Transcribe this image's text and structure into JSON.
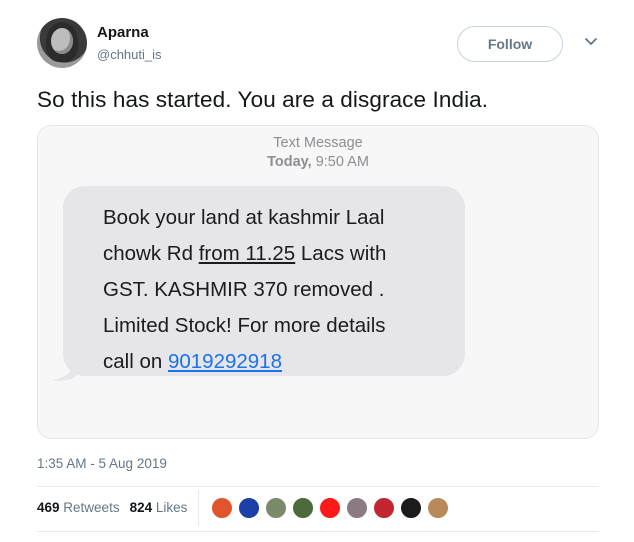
{
  "author": {
    "name": "Aparna",
    "handle": "@chhuti_is",
    "avatar_icon": "user-avatar-photo"
  },
  "header": {
    "follow_label": "Follow",
    "caret_icon": "chevron-down-icon"
  },
  "tweet": {
    "text": "So this has started. You are a disgrace India.",
    "timestamp": "1:35 AM - 5 Aug 2019"
  },
  "sms": {
    "title": "Text Message",
    "time_day": "Today,",
    "time_clock": "9:50 AM",
    "lines": [
      "Book your land at kashmir Laal",
      "chowk Rd ",
      "from 11.25",
      " Lacs with",
      "GST.  KASHMIR 370 removed .",
      "Limited Stock! For more details",
      "call on ",
      "9019292918"
    ],
    "colors": {
      "bubble": "#e5e5ea",
      "link": "#1a73e8"
    }
  },
  "stats": {
    "retweets_count": "469",
    "retweets_label": "Retweets",
    "likes_count": "824",
    "likes_label": "Likes"
  },
  "likers": [
    {
      "name": "liker-avatar-1",
      "color": "#e0542e"
    },
    {
      "name": "liker-avatar-2",
      "color": "#1d3fa8"
    },
    {
      "name": "liker-avatar-3",
      "color": "#7b8a6a"
    },
    {
      "name": "liker-avatar-4",
      "color": "#4b6b3a"
    },
    {
      "name": "liker-avatar-5",
      "color": "#ff1a1a"
    },
    {
      "name": "liker-avatar-6",
      "color": "#8a7a84"
    },
    {
      "name": "liker-avatar-7",
      "color": "#c2262e"
    },
    {
      "name": "liker-avatar-8",
      "color": "#1b1b1b"
    },
    {
      "name": "liker-avatar-9",
      "color": "#b88a5a"
    }
  ]
}
